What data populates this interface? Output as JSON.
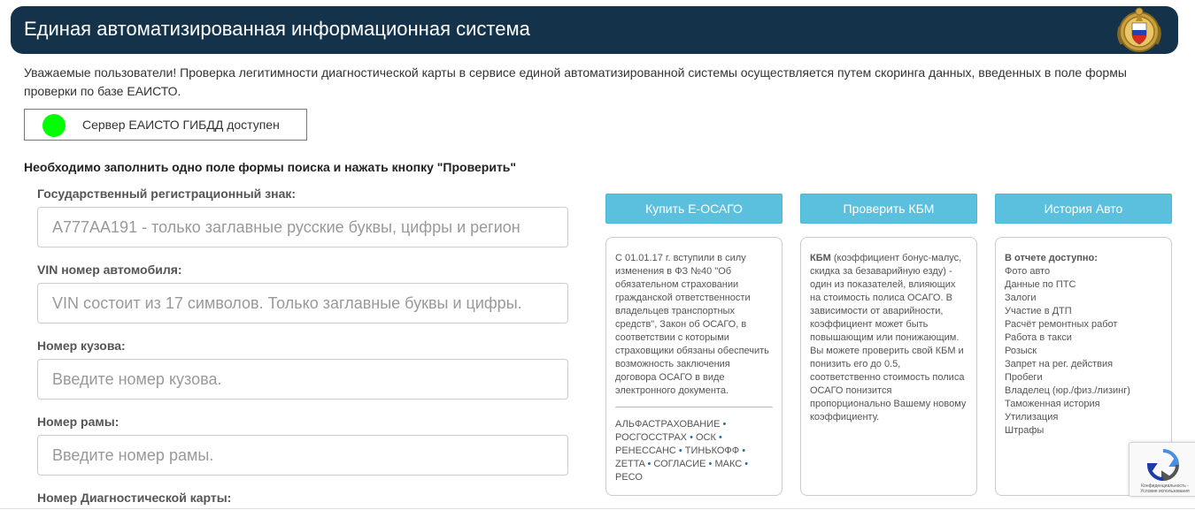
{
  "header": {
    "title": "Единая автоматизированная информационная система",
    "emblem_icon": "gibdd-emblem-icon"
  },
  "notice": {
    "text": "Уважаемые пользователи! Проверка легитимности диагностической карты в сервисе единой автоматизированной системы осуществляется путем скоринга данных, введенных в поле формы проверки по базе ЕАИСТО."
  },
  "server_status": {
    "text": "Сервер ЕАИСТО ГИБДД доступен",
    "color": "#00ff00"
  },
  "instructions": "Необходимо заполнить одно поле формы поиска и нажать кнопку \"Проверить\"",
  "form": {
    "fields": [
      {
        "label": "Государственный регистрационный знак:",
        "value": "",
        "placeholder": "А777АА191 - только заглавные русские буквы, цифры и регион"
      },
      {
        "label": "VIN номер автомобиля:",
        "value": "",
        "placeholder": "VIN состоит из 17 символов. Только заглавные буквы и цифры."
      },
      {
        "label": "Номер кузова:",
        "value": "",
        "placeholder": "Введите номер кузова."
      },
      {
        "label": "Номер рамы:",
        "value": "",
        "placeholder": "Введите номер рамы."
      },
      {
        "label": "Номер Диагностической карты:"
      }
    ]
  },
  "buttons": {
    "osago": "Купить Е-ОСАГО",
    "kbm": "Проверить КБМ",
    "history": "История Авто"
  },
  "cards": {
    "osago": {
      "text": "С 01.01.17 г. вступили в силу изменения в ФЗ №40 \"Об обязательном страховании гражданской ответственности владельцев транспортных средств\", Закон об ОСАГО, в соответствии с которыми страховщики обязаны обеспечить возможность заключения договора ОСАГО в виде электронного документа.",
      "insurers": [
        "АЛЬФАСТРАХОВАНИЕ",
        "РОСГОССТРАХ",
        "ОСК",
        "РЕНЕССАНС",
        "ТИНЬКОФФ",
        "ZETTA",
        "СОГЛАСИЕ",
        "МАКС",
        "РЕСО"
      ],
      "separator": " • "
    },
    "kbm": {
      "term": "КБМ",
      "text": " (коэффициент бонус-малус, скидка за безаварийную езду) - один из показателей, влияющих на стоимость полиса ОСАГО. В зависимости от аварийности, коэффициент может быть повышающим или понижающим. Вы можете проверить свой КБМ и понизить его до 0.5, соответственно стоимость полиса ОСАГО понизится пропорционально Вашему новому коэффициенту."
    },
    "history": {
      "heading": "В отчете доступно:",
      "items": [
        "Фото авто",
        "Данные по ПТС",
        "Залоги",
        "Участие в ДТП",
        "Расчёт ремонтных работ",
        "Работа в такси",
        "Розыск",
        "Запрет на рег. действия",
        "Пробеги",
        "Владелец (юр./физ./лизинг)",
        "Таможенная история",
        "Утилизация",
        "Штрафы"
      ]
    }
  },
  "recaptcha": {
    "text": "Конфиденциальность - Условия использования",
    "icon": "recaptcha-icon"
  },
  "colors": {
    "header_bg": "#14334a",
    "button_bg": "#5bc0de",
    "status_green": "#00ff00"
  }
}
